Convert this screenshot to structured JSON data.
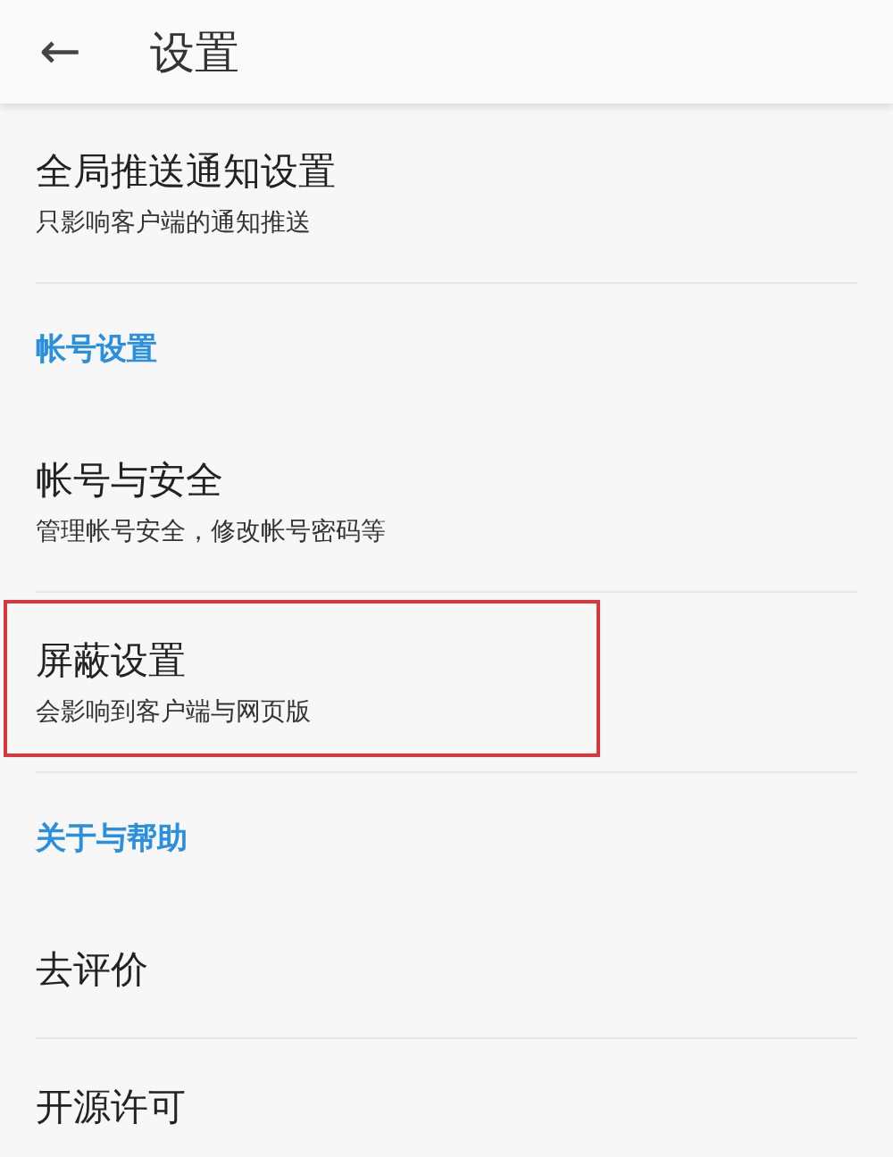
{
  "header": {
    "back": "←",
    "title": "设置"
  },
  "list": [
    {
      "kind": "item",
      "title": "全局推送通知设置",
      "subtitle": "只影响客户端的通知推送",
      "highlighted": false,
      "divider": true
    },
    {
      "kind": "section",
      "title": "帐号设置"
    },
    {
      "kind": "item",
      "title": "帐号与安全",
      "subtitle": "管理帐号安全，修改帐号密码等",
      "highlighted": false,
      "divider": true
    },
    {
      "kind": "item",
      "title": "屏蔽设置",
      "subtitle": "会影响到客户端与网页版",
      "highlighted": true,
      "divider": true
    },
    {
      "kind": "section",
      "title": "关于与帮助"
    },
    {
      "kind": "item",
      "title": "去评价",
      "highlighted": false,
      "divider": true
    },
    {
      "kind": "item",
      "title": "开源许可",
      "highlighted": false,
      "divider": false
    }
  ]
}
